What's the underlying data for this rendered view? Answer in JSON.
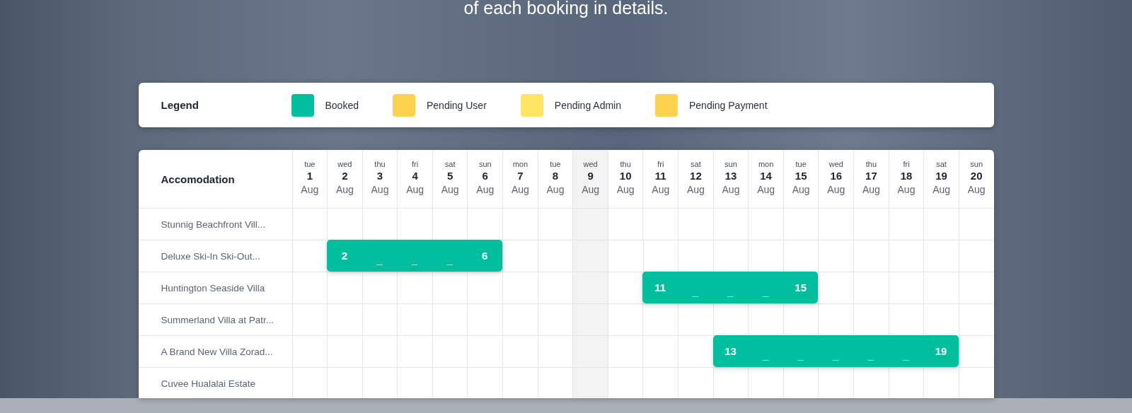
{
  "headline": "of each booking in details.",
  "legend": {
    "title": "Legend",
    "items": [
      {
        "kind": "booked",
        "label": "Booked",
        "color": "#00bf9f"
      },
      {
        "kind": "pending_user",
        "label": "Pending User",
        "color": "#fdd24f"
      },
      {
        "kind": "pending_admin",
        "label": "Pending Admin",
        "color": "#ffe363"
      },
      {
        "kind": "pending_payment",
        "label": "Pending Payment",
        "color": "#fdd24f"
      }
    ]
  },
  "calendar": {
    "heading": "Accomodation",
    "days": [
      {
        "weekday": "tue",
        "day": "1",
        "month": "Aug",
        "highlighted": false
      },
      {
        "weekday": "wed",
        "day": "2",
        "month": "Aug",
        "highlighted": false
      },
      {
        "weekday": "thu",
        "day": "3",
        "month": "Aug",
        "highlighted": false
      },
      {
        "weekday": "fri",
        "day": "4",
        "month": "Aug",
        "highlighted": false
      },
      {
        "weekday": "sat",
        "day": "5",
        "month": "Aug",
        "highlighted": false
      },
      {
        "weekday": "sun",
        "day": "6",
        "month": "Aug",
        "highlighted": false
      },
      {
        "weekday": "mon",
        "day": "7",
        "month": "Aug",
        "highlighted": false
      },
      {
        "weekday": "tue",
        "day": "8",
        "month": "Aug",
        "highlighted": false
      },
      {
        "weekday": "wed",
        "day": "9",
        "month": "Aug",
        "highlighted": true
      },
      {
        "weekday": "thu",
        "day": "10",
        "month": "Aug",
        "highlighted": false
      },
      {
        "weekday": "fri",
        "day": "11",
        "month": "Aug",
        "highlighted": false
      },
      {
        "weekday": "sat",
        "day": "12",
        "month": "Aug",
        "highlighted": false
      },
      {
        "weekday": "sun",
        "day": "13",
        "month": "Aug",
        "highlighted": false
      },
      {
        "weekday": "mon",
        "day": "14",
        "month": "Aug",
        "highlighted": false
      },
      {
        "weekday": "tue",
        "day": "15",
        "month": "Aug",
        "highlighted": false
      },
      {
        "weekday": "wed",
        "day": "16",
        "month": "Aug",
        "highlighted": false
      },
      {
        "weekday": "thu",
        "day": "17",
        "month": "Aug",
        "highlighted": false
      },
      {
        "weekday": "fri",
        "day": "18",
        "month": "Aug",
        "highlighted": false
      },
      {
        "weekday": "sat",
        "day": "19",
        "month": "Aug",
        "highlighted": false
      },
      {
        "weekday": "sun",
        "day": "20",
        "month": "Aug",
        "highlighted": false
      }
    ],
    "rows": [
      {
        "name": "Stunnig Beachfront Vill...",
        "cells": [
          {
            "kind": "free"
          },
          {
            "kind": "free"
          },
          {
            "kind": "free"
          },
          {
            "kind": "free"
          },
          {
            "kind": "free"
          },
          {
            "kind": "free"
          },
          {
            "kind": "free"
          },
          {
            "kind": "free"
          },
          {
            "kind": "free"
          },
          {
            "kind": "free"
          },
          {
            "kind": "free"
          },
          {
            "kind": "free"
          },
          {
            "kind": "free"
          },
          {
            "kind": "free"
          },
          {
            "kind": "free"
          },
          {
            "kind": "free"
          },
          {
            "kind": "free"
          },
          {
            "kind": "free"
          },
          {
            "kind": "free"
          },
          {
            "kind": "free"
          }
        ]
      },
      {
        "name": "Deluxe Ski-In Ski-Out...",
        "cells": [
          {
            "kind": "free"
          },
          {
            "kind": "booked",
            "text": "2"
          },
          {
            "kind": "booked",
            "text": "_"
          },
          {
            "kind": "booked",
            "text": "_"
          },
          {
            "kind": "booked",
            "text": "_"
          },
          {
            "kind": "booked",
            "text": "6"
          },
          {
            "kind": "free"
          },
          {
            "kind": "free"
          },
          {
            "kind": "free"
          },
          {
            "kind": "free"
          },
          {
            "kind": "free"
          },
          {
            "kind": "free"
          },
          {
            "kind": "free"
          },
          {
            "kind": "free"
          },
          {
            "kind": "free"
          },
          {
            "kind": "free"
          },
          {
            "kind": "free"
          },
          {
            "kind": "free"
          },
          {
            "kind": "free"
          },
          {
            "kind": "free"
          }
        ]
      },
      {
        "name": "Huntington Seaside Villa",
        "cells": [
          {
            "kind": "free"
          },
          {
            "kind": "free"
          },
          {
            "kind": "free"
          },
          {
            "kind": "free"
          },
          {
            "kind": "free"
          },
          {
            "kind": "free"
          },
          {
            "kind": "free"
          },
          {
            "kind": "free"
          },
          {
            "kind": "free"
          },
          {
            "kind": "free"
          },
          {
            "kind": "booked",
            "text": "11"
          },
          {
            "kind": "booked",
            "text": "_"
          },
          {
            "kind": "booked",
            "text": "_"
          },
          {
            "kind": "booked",
            "text": "_"
          },
          {
            "kind": "booked",
            "text": "15"
          },
          {
            "kind": "free"
          },
          {
            "kind": "free"
          },
          {
            "kind": "free"
          },
          {
            "kind": "free"
          },
          {
            "kind": "free"
          }
        ]
      },
      {
        "name": "Summerland Villa at Patr...",
        "cells": [
          {
            "kind": "free"
          },
          {
            "kind": "free"
          },
          {
            "kind": "free"
          },
          {
            "kind": "free"
          },
          {
            "kind": "free"
          },
          {
            "kind": "free"
          },
          {
            "kind": "free"
          },
          {
            "kind": "free"
          },
          {
            "kind": "free"
          },
          {
            "kind": "free"
          },
          {
            "kind": "free"
          },
          {
            "kind": "free"
          },
          {
            "kind": "free"
          },
          {
            "kind": "free"
          },
          {
            "kind": "free"
          },
          {
            "kind": "free"
          },
          {
            "kind": "free"
          },
          {
            "kind": "free"
          },
          {
            "kind": "free"
          },
          {
            "kind": "free"
          }
        ]
      },
      {
        "name": "A Brand New Villa Zorad...",
        "cells": [
          {
            "kind": "free"
          },
          {
            "kind": "free"
          },
          {
            "kind": "free"
          },
          {
            "kind": "free"
          },
          {
            "kind": "free"
          },
          {
            "kind": "free"
          },
          {
            "kind": "free"
          },
          {
            "kind": "free"
          },
          {
            "kind": "free"
          },
          {
            "kind": "free"
          },
          {
            "kind": "free"
          },
          {
            "kind": "free"
          },
          {
            "kind": "booked",
            "text": "13"
          },
          {
            "kind": "booked",
            "text": "_"
          },
          {
            "kind": "booked",
            "text": "_"
          },
          {
            "kind": "booked",
            "text": "_"
          },
          {
            "kind": "booked",
            "text": "_"
          },
          {
            "kind": "booked",
            "text": "_"
          },
          {
            "kind": "booked",
            "text": "19"
          },
          {
            "kind": "free"
          }
        ]
      },
      {
        "name": "Cuvee Hualalai Estate",
        "cells": [
          {
            "kind": "free"
          },
          {
            "kind": "free"
          },
          {
            "kind": "free"
          },
          {
            "kind": "free"
          },
          {
            "kind": "free"
          },
          {
            "kind": "free"
          },
          {
            "kind": "free"
          },
          {
            "kind": "free"
          },
          {
            "kind": "free"
          },
          {
            "kind": "free"
          },
          {
            "kind": "free"
          },
          {
            "kind": "free"
          },
          {
            "kind": "free"
          },
          {
            "kind": "free"
          },
          {
            "kind": "free"
          },
          {
            "kind": "free"
          },
          {
            "kind": "free"
          },
          {
            "kind": "free"
          },
          {
            "kind": "free"
          },
          {
            "kind": "free"
          }
        ]
      }
    ]
  }
}
